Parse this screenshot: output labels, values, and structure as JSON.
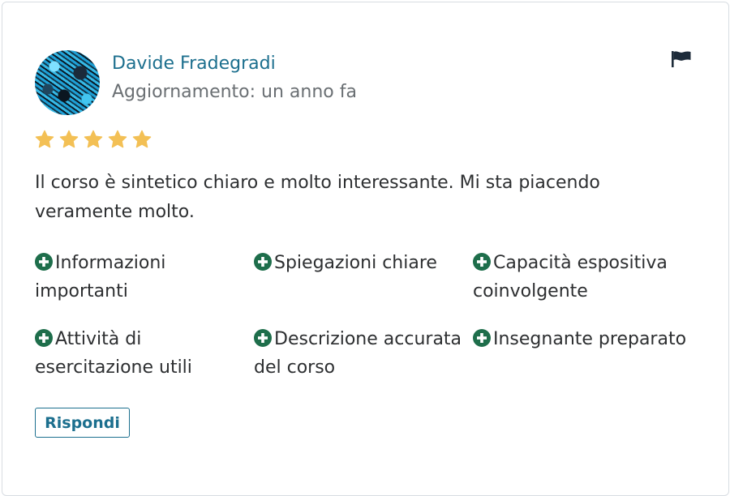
{
  "review": {
    "reviewer_name": "Davide Fradegradi",
    "updated": "Aggiornamento: un anno fa",
    "rating": 5,
    "text": "Il corso è sintetico chiaro e molto interessante. Mi sta piacendo veramente molto.",
    "tags": [
      "Informazioni importanti",
      "Spiegazioni chiare",
      "Capacità espositiva coinvolgente",
      "Attività di esercitazione utili",
      "Descrizione accurata del corso",
      "Insegnante preparato"
    ],
    "reply_label": "Rispondi"
  },
  "icons": {
    "flag": "flag-icon",
    "star": "star-icon",
    "tag": "plus-circle-icon"
  },
  "colors": {
    "accent": "#1c6f8e",
    "star": "#f3c055",
    "tag_icon": "#1e6e4b",
    "flag": "#1d2b3a",
    "muted_text": "#6a6f73"
  }
}
